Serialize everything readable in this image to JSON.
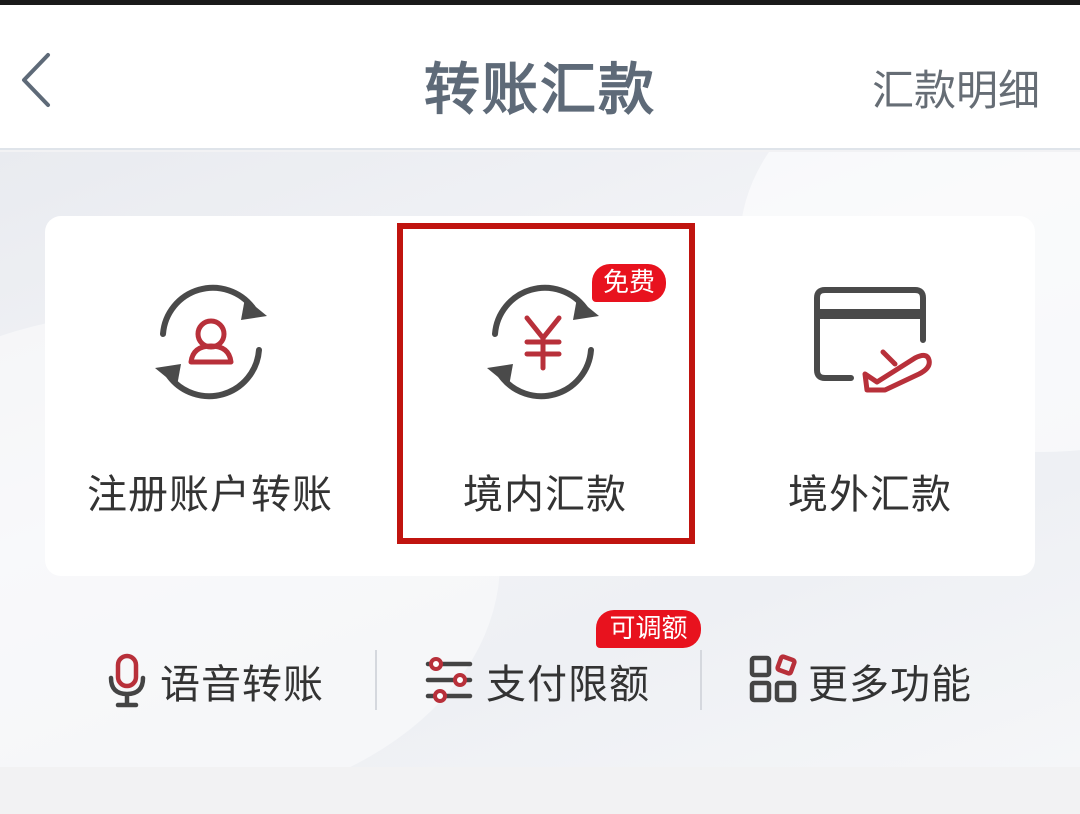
{
  "header": {
    "title": "转账汇款",
    "detail_link": "汇款明细"
  },
  "main_tiles": [
    {
      "label": "注册账户转账",
      "icon": "account-transfer-icon"
    },
    {
      "label": "境内汇款",
      "icon": "yuan-exchange-icon",
      "badge": "免费"
    },
    {
      "label": "境外汇款",
      "icon": "card-plane-icon"
    }
  ],
  "tools": [
    {
      "label": "语音转账",
      "icon": "microphone-icon"
    },
    {
      "label": "支付限额",
      "icon": "sliders-icon",
      "badge": "可调额"
    },
    {
      "label": "更多功能",
      "icon": "grid-apps-icon"
    }
  ],
  "colors": {
    "accent_red": "#e8121e",
    "highlight_border": "#c0140f",
    "title_text": "#5e6a78"
  }
}
